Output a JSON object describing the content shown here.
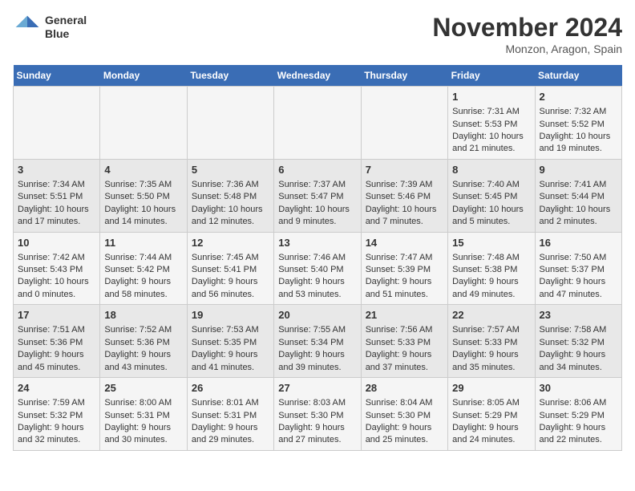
{
  "header": {
    "logo_line1": "General",
    "logo_line2": "Blue",
    "month": "November 2024",
    "location": "Monzon, Aragon, Spain"
  },
  "weekdays": [
    "Sunday",
    "Monday",
    "Tuesday",
    "Wednesday",
    "Thursday",
    "Friday",
    "Saturday"
  ],
  "weeks": [
    [
      {
        "day": "",
        "content": ""
      },
      {
        "day": "",
        "content": ""
      },
      {
        "day": "",
        "content": ""
      },
      {
        "day": "",
        "content": ""
      },
      {
        "day": "",
        "content": ""
      },
      {
        "day": "1",
        "content": "Sunrise: 7:31 AM\nSunset: 5:53 PM\nDaylight: 10 hours\nand 21 minutes."
      },
      {
        "day": "2",
        "content": "Sunrise: 7:32 AM\nSunset: 5:52 PM\nDaylight: 10 hours\nand 19 minutes."
      }
    ],
    [
      {
        "day": "3",
        "content": "Sunrise: 7:34 AM\nSunset: 5:51 PM\nDaylight: 10 hours\nand 17 minutes."
      },
      {
        "day": "4",
        "content": "Sunrise: 7:35 AM\nSunset: 5:50 PM\nDaylight: 10 hours\nand 14 minutes."
      },
      {
        "day": "5",
        "content": "Sunrise: 7:36 AM\nSunset: 5:48 PM\nDaylight: 10 hours\nand 12 minutes."
      },
      {
        "day": "6",
        "content": "Sunrise: 7:37 AM\nSunset: 5:47 PM\nDaylight: 10 hours\nand 9 minutes."
      },
      {
        "day": "7",
        "content": "Sunrise: 7:39 AM\nSunset: 5:46 PM\nDaylight: 10 hours\nand 7 minutes."
      },
      {
        "day": "8",
        "content": "Sunrise: 7:40 AM\nSunset: 5:45 PM\nDaylight: 10 hours\nand 5 minutes."
      },
      {
        "day": "9",
        "content": "Sunrise: 7:41 AM\nSunset: 5:44 PM\nDaylight: 10 hours\nand 2 minutes."
      }
    ],
    [
      {
        "day": "10",
        "content": "Sunrise: 7:42 AM\nSunset: 5:43 PM\nDaylight: 10 hours\nand 0 minutes."
      },
      {
        "day": "11",
        "content": "Sunrise: 7:44 AM\nSunset: 5:42 PM\nDaylight: 9 hours\nand 58 minutes."
      },
      {
        "day": "12",
        "content": "Sunrise: 7:45 AM\nSunset: 5:41 PM\nDaylight: 9 hours\nand 56 minutes."
      },
      {
        "day": "13",
        "content": "Sunrise: 7:46 AM\nSunset: 5:40 PM\nDaylight: 9 hours\nand 53 minutes."
      },
      {
        "day": "14",
        "content": "Sunrise: 7:47 AM\nSunset: 5:39 PM\nDaylight: 9 hours\nand 51 minutes."
      },
      {
        "day": "15",
        "content": "Sunrise: 7:48 AM\nSunset: 5:38 PM\nDaylight: 9 hours\nand 49 minutes."
      },
      {
        "day": "16",
        "content": "Sunrise: 7:50 AM\nSunset: 5:37 PM\nDaylight: 9 hours\nand 47 minutes."
      }
    ],
    [
      {
        "day": "17",
        "content": "Sunrise: 7:51 AM\nSunset: 5:36 PM\nDaylight: 9 hours\nand 45 minutes."
      },
      {
        "day": "18",
        "content": "Sunrise: 7:52 AM\nSunset: 5:36 PM\nDaylight: 9 hours\nand 43 minutes."
      },
      {
        "day": "19",
        "content": "Sunrise: 7:53 AM\nSunset: 5:35 PM\nDaylight: 9 hours\nand 41 minutes."
      },
      {
        "day": "20",
        "content": "Sunrise: 7:55 AM\nSunset: 5:34 PM\nDaylight: 9 hours\nand 39 minutes."
      },
      {
        "day": "21",
        "content": "Sunrise: 7:56 AM\nSunset: 5:33 PM\nDaylight: 9 hours\nand 37 minutes."
      },
      {
        "day": "22",
        "content": "Sunrise: 7:57 AM\nSunset: 5:33 PM\nDaylight: 9 hours\nand 35 minutes."
      },
      {
        "day": "23",
        "content": "Sunrise: 7:58 AM\nSunset: 5:32 PM\nDaylight: 9 hours\nand 34 minutes."
      }
    ],
    [
      {
        "day": "24",
        "content": "Sunrise: 7:59 AM\nSunset: 5:32 PM\nDaylight: 9 hours\nand 32 minutes."
      },
      {
        "day": "25",
        "content": "Sunrise: 8:00 AM\nSunset: 5:31 PM\nDaylight: 9 hours\nand 30 minutes."
      },
      {
        "day": "26",
        "content": "Sunrise: 8:01 AM\nSunset: 5:31 PM\nDaylight: 9 hours\nand 29 minutes."
      },
      {
        "day": "27",
        "content": "Sunrise: 8:03 AM\nSunset: 5:30 PM\nDaylight: 9 hours\nand 27 minutes."
      },
      {
        "day": "28",
        "content": "Sunrise: 8:04 AM\nSunset: 5:30 PM\nDaylight: 9 hours\nand 25 minutes."
      },
      {
        "day": "29",
        "content": "Sunrise: 8:05 AM\nSunset: 5:29 PM\nDaylight: 9 hours\nand 24 minutes."
      },
      {
        "day": "30",
        "content": "Sunrise: 8:06 AM\nSunset: 5:29 PM\nDaylight: 9 hours\nand 22 minutes."
      }
    ]
  ]
}
